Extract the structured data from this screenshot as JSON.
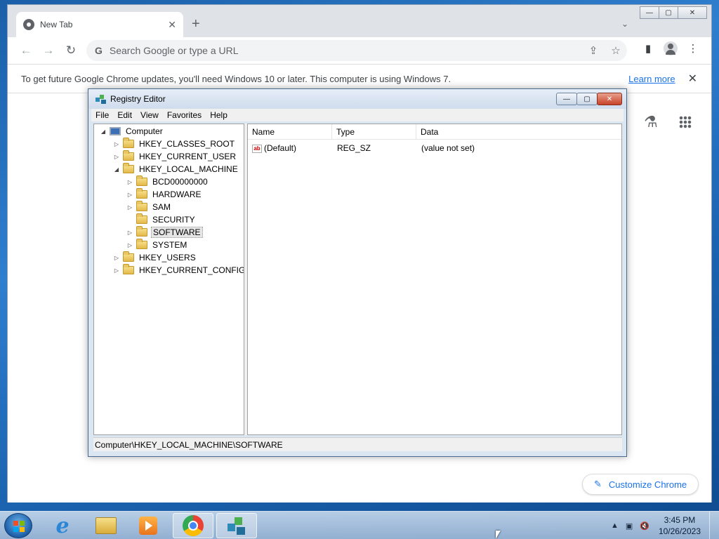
{
  "chrome": {
    "tab_title": "New Tab",
    "tab_close": "✕",
    "new_tab": "+",
    "tab_search": "⌄",
    "window_buttons": {
      "minimize": "—",
      "maximize": "▢",
      "close": "✕"
    },
    "nav": {
      "back": "←",
      "forward": "→",
      "reload": "↻"
    },
    "omnibox": {
      "g": "G",
      "placeholder": "Search Google or type a URL",
      "share": "⇪",
      "bookmark": "☆"
    },
    "side_panel": "▮",
    "menu": "⋮",
    "infobar": {
      "text": "To get future Google Chrome updates, you'll need Windows 10 or later. This computer is using Windows 7.",
      "link": "Learn more",
      "close": "✕"
    },
    "content": {
      "labs": "⚗",
      "customize": "Customize Chrome",
      "pencil": "✎"
    }
  },
  "regedit": {
    "title": "Registry Editor",
    "window_buttons": {
      "minimize": "—",
      "maximize": "▢",
      "close": "✕"
    },
    "menu": [
      "File",
      "Edit",
      "View",
      "Favorites",
      "Help"
    ],
    "tree": {
      "computer": "Computer",
      "hkcr": "HKEY_CLASSES_ROOT",
      "hkcu": "HKEY_CURRENT_USER",
      "hklm": "HKEY_LOCAL_MACHINE",
      "bcd": "BCD00000000",
      "hardware": "HARDWARE",
      "sam": "SAM",
      "security": "SECURITY",
      "software": "SOFTWARE",
      "system": "SYSTEM",
      "hku": "HKEY_USERS",
      "hkcc": "HKEY_CURRENT_CONFIG"
    },
    "expander": {
      "collapsed": "▷",
      "expanded": "◢",
      "leaf": ""
    },
    "columns": {
      "name": "Name",
      "type": "Type",
      "data": "Data"
    },
    "row": {
      "icon": "ab",
      "name": "(Default)",
      "type": "REG_SZ",
      "data": "(value not set)"
    },
    "status": "Computer\\HKEY_LOCAL_MACHINE\\SOFTWARE"
  },
  "taskbar": {
    "tray_arrow": "▲",
    "network": "▣",
    "volume": "🔇",
    "time": "3:45 PM",
    "date": "10/26/2023"
  }
}
